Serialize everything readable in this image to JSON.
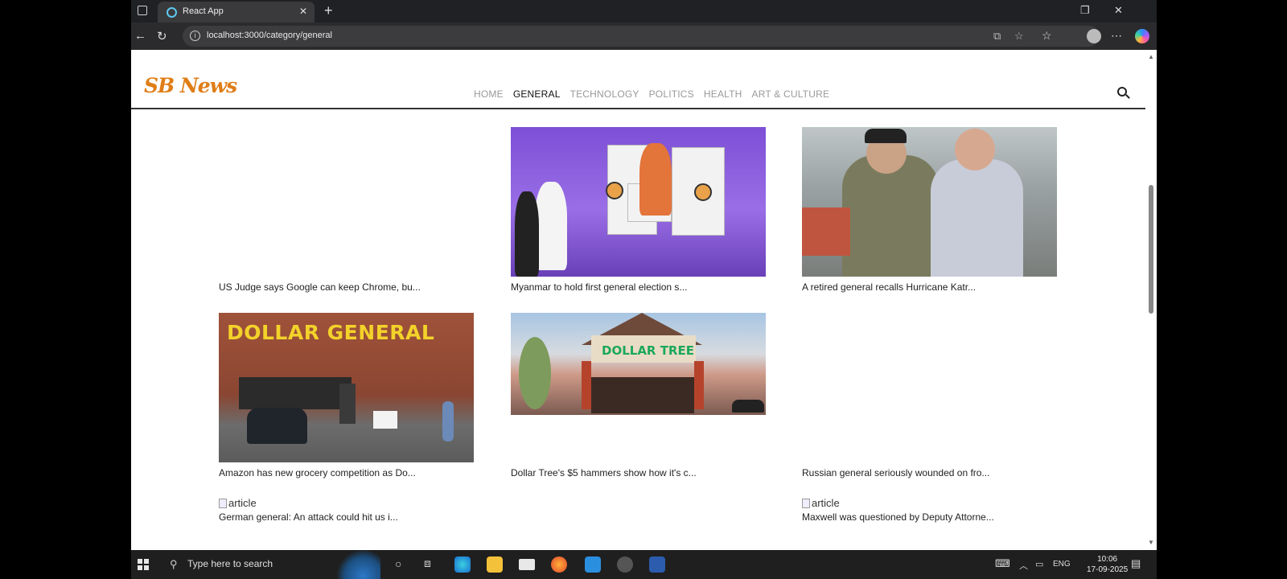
{
  "browser": {
    "tab_title": "React App",
    "url": "localhost:3000/category/general"
  },
  "site": {
    "logo": "SB News",
    "nav": [
      "HOME",
      "GENERAL",
      "TECHNOLOGY",
      "POLITICS",
      "HEALTH",
      "ART & CULTURE"
    ],
    "active_nav": "GENERAL"
  },
  "articles": [
    {
      "caption": "US Judge says Google can keep Chrome, bu...",
      "image": "none"
    },
    {
      "caption": "Myanmar to hold first general election s...",
      "image": "election-photo"
    },
    {
      "caption": "A retired general recalls Hurricane Katr...",
      "image": "generals-photo"
    },
    {
      "caption": "Amazon has new grocery competition as Do...",
      "image": "dollar-general-photo",
      "image_text": "DOLLAR GENERAL"
    },
    {
      "caption": "Dollar Tree's $5 hammers show how it's c...",
      "image": "dollar-tree-photo",
      "image_text": "DOLLAR TREE"
    },
    {
      "caption": "Russian general seriously wounded on fro...",
      "image": "none"
    },
    {
      "caption": "German general: An attack could hit us i...",
      "image": "broken",
      "alt": "article"
    },
    {
      "caption": "Maxwell was questioned by Deputy Attorne...",
      "image": "broken",
      "alt": "article"
    }
  ],
  "taskbar": {
    "search_placeholder": "Type here to search",
    "language": "ENG",
    "time": "10:06",
    "date": "17-09-2025"
  }
}
